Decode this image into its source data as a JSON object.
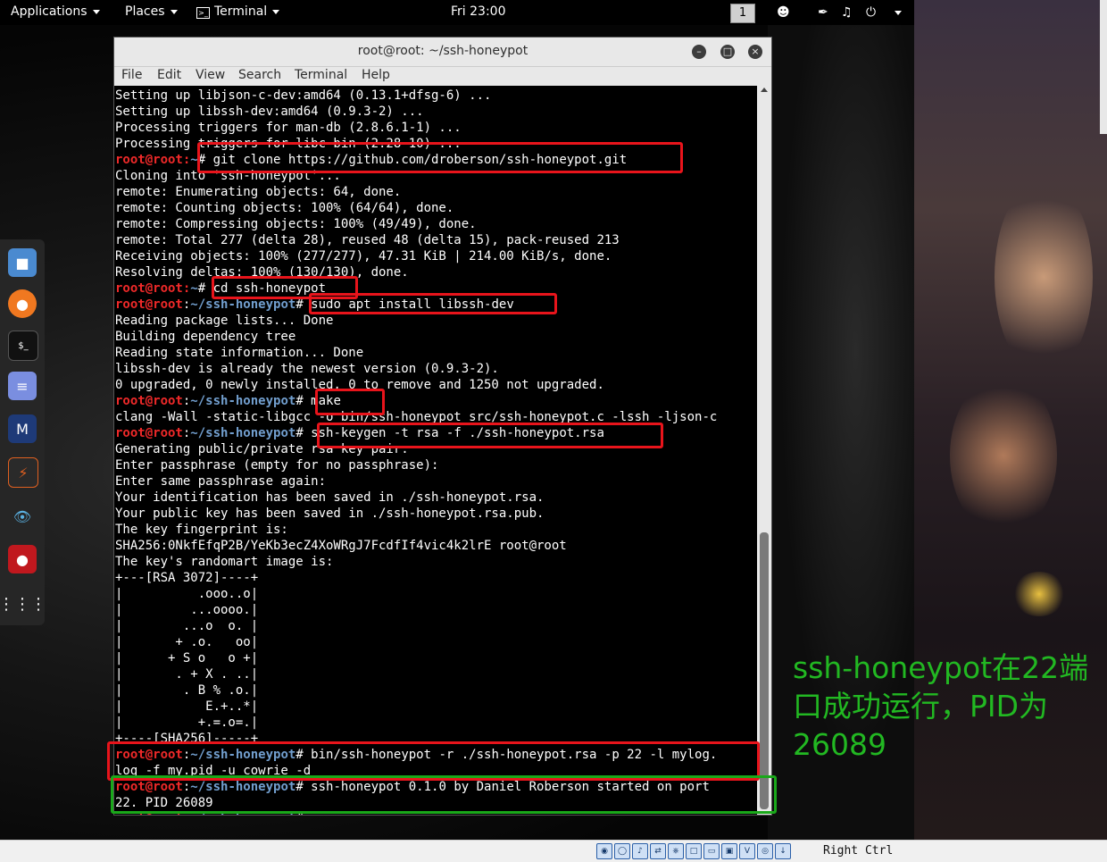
{
  "topbar": {
    "applications": "Applications",
    "places": "Places",
    "terminal": "Terminal",
    "clock": "Fri 23:00",
    "workspace": "1"
  },
  "window": {
    "title": "root@root: ~/ssh-honeypot",
    "menu": [
      "File",
      "Edit",
      "View",
      "Search",
      "Terminal",
      "Help"
    ]
  },
  "prompt": {
    "user": "root@root",
    "sep": ":",
    "home": "~",
    "dir": "~/ssh-honeypot",
    "symbol": "#"
  },
  "terminal_lines": [
    {
      "text": "Setting up libjson-c-dev:amd64 (0.13.1+dfsg-6) ..."
    },
    {
      "text": "Setting up libssh-dev:amd64 (0.9.3-2) ..."
    },
    {
      "text": "Processing triggers for man-db (2.8.6.1-1) ..."
    },
    {
      "text": "Processing triggers for libc-bin (2.28-10) ..."
    },
    {
      "prompt": "home",
      "cmd": " git clone https://github.com/droberson/ssh-honeypot.git"
    },
    {
      "text": "Cloning into 'ssh-honeypot'..."
    },
    {
      "text": "remote: Enumerating objects: 64, done."
    },
    {
      "text": "remote: Counting objects: 100% (64/64), done."
    },
    {
      "text": "remote: Compressing objects: 100% (49/49), done."
    },
    {
      "text": "remote: Total 277 (delta 28), reused 48 (delta 15), pack-reused 213"
    },
    {
      "text": "Receiving objects: 100% (277/277), 47.31 KiB | 214.00 KiB/s, done."
    },
    {
      "text": "Resolving deltas: 100% (130/130), done."
    },
    {
      "prompt": "home",
      "cmd": " cd ssh-honeypot"
    },
    {
      "prompt": "dir",
      "cmd": " sudo apt install libssh-dev"
    },
    {
      "text": "Reading package lists... Done"
    },
    {
      "text": "Building dependency tree"
    },
    {
      "text": "Reading state information... Done"
    },
    {
      "text": "libssh-dev is already the newest version (0.9.3-2)."
    },
    {
      "text": "0 upgraded, 0 newly installed, 0 to remove and 1250 not upgraded."
    },
    {
      "prompt": "dir",
      "cmd": " make"
    },
    {
      "text": "clang -Wall -static-libgcc -o bin/ssh-honeypot src/ssh-honeypot.c -lssh -ljson-c"
    },
    {
      "prompt": "dir",
      "cmd": " ssh-keygen -t rsa -f ./ssh-honeypot.rsa"
    },
    {
      "text": "Generating public/private rsa key pair."
    },
    {
      "text": "Enter passphrase (empty for no passphrase):"
    },
    {
      "text": "Enter same passphrase again:"
    },
    {
      "text": "Your identification has been saved in ./ssh-honeypot.rsa."
    },
    {
      "text": "Your public key has been saved in ./ssh-honeypot.rsa.pub."
    },
    {
      "text": "The key fingerprint is:"
    },
    {
      "text": "SHA256:0NkfEfqP2B/YeKb3ecZ4XoWRgJ7FcdfIf4vic4k2lrE root@root"
    },
    {
      "text": "The key's randomart image is:"
    },
    {
      "text": "+---[RSA 3072]----+"
    },
    {
      "text": "|          .ooo..o|"
    },
    {
      "text": "|         ...oooo.|"
    },
    {
      "text": "|        ...o  o. |"
    },
    {
      "text": "|       + .o.   oo|"
    },
    {
      "text": "|      + S o   o +|"
    },
    {
      "text": "|       . + X . ..|"
    },
    {
      "text": "|        . B % .o.|"
    },
    {
      "text": "|           E.+..*|"
    },
    {
      "text": "|          +.=.o=.|"
    },
    {
      "text": "+----[SHA256]-----+"
    },
    {
      "prompt": "dir",
      "cmd": " bin/ssh-honeypot -r ./ssh-honeypot.rsa -p 22 -l mylog."
    },
    {
      "text": "log -f my.pid -u cowrie -d"
    },
    {
      "prompt": "dir",
      "cmd": " ssh-honeypot 0.1.0 by Daniel Roberson started on port"
    },
    {
      "text": "22. PID 26089"
    },
    {
      "prompt": "dir",
      "cmd": ""
    }
  ],
  "annotation": "ssh-honeypot在22端口成功运行，PID为26089",
  "statusbar": {
    "host_key": "Right Ctrl"
  },
  "colors": {
    "prompt_user": "#ef2929",
    "prompt_path": "#729fcf",
    "highlight_red": "#e8141b",
    "highlight_green": "#1aa81a",
    "annotation": "#22b822"
  }
}
